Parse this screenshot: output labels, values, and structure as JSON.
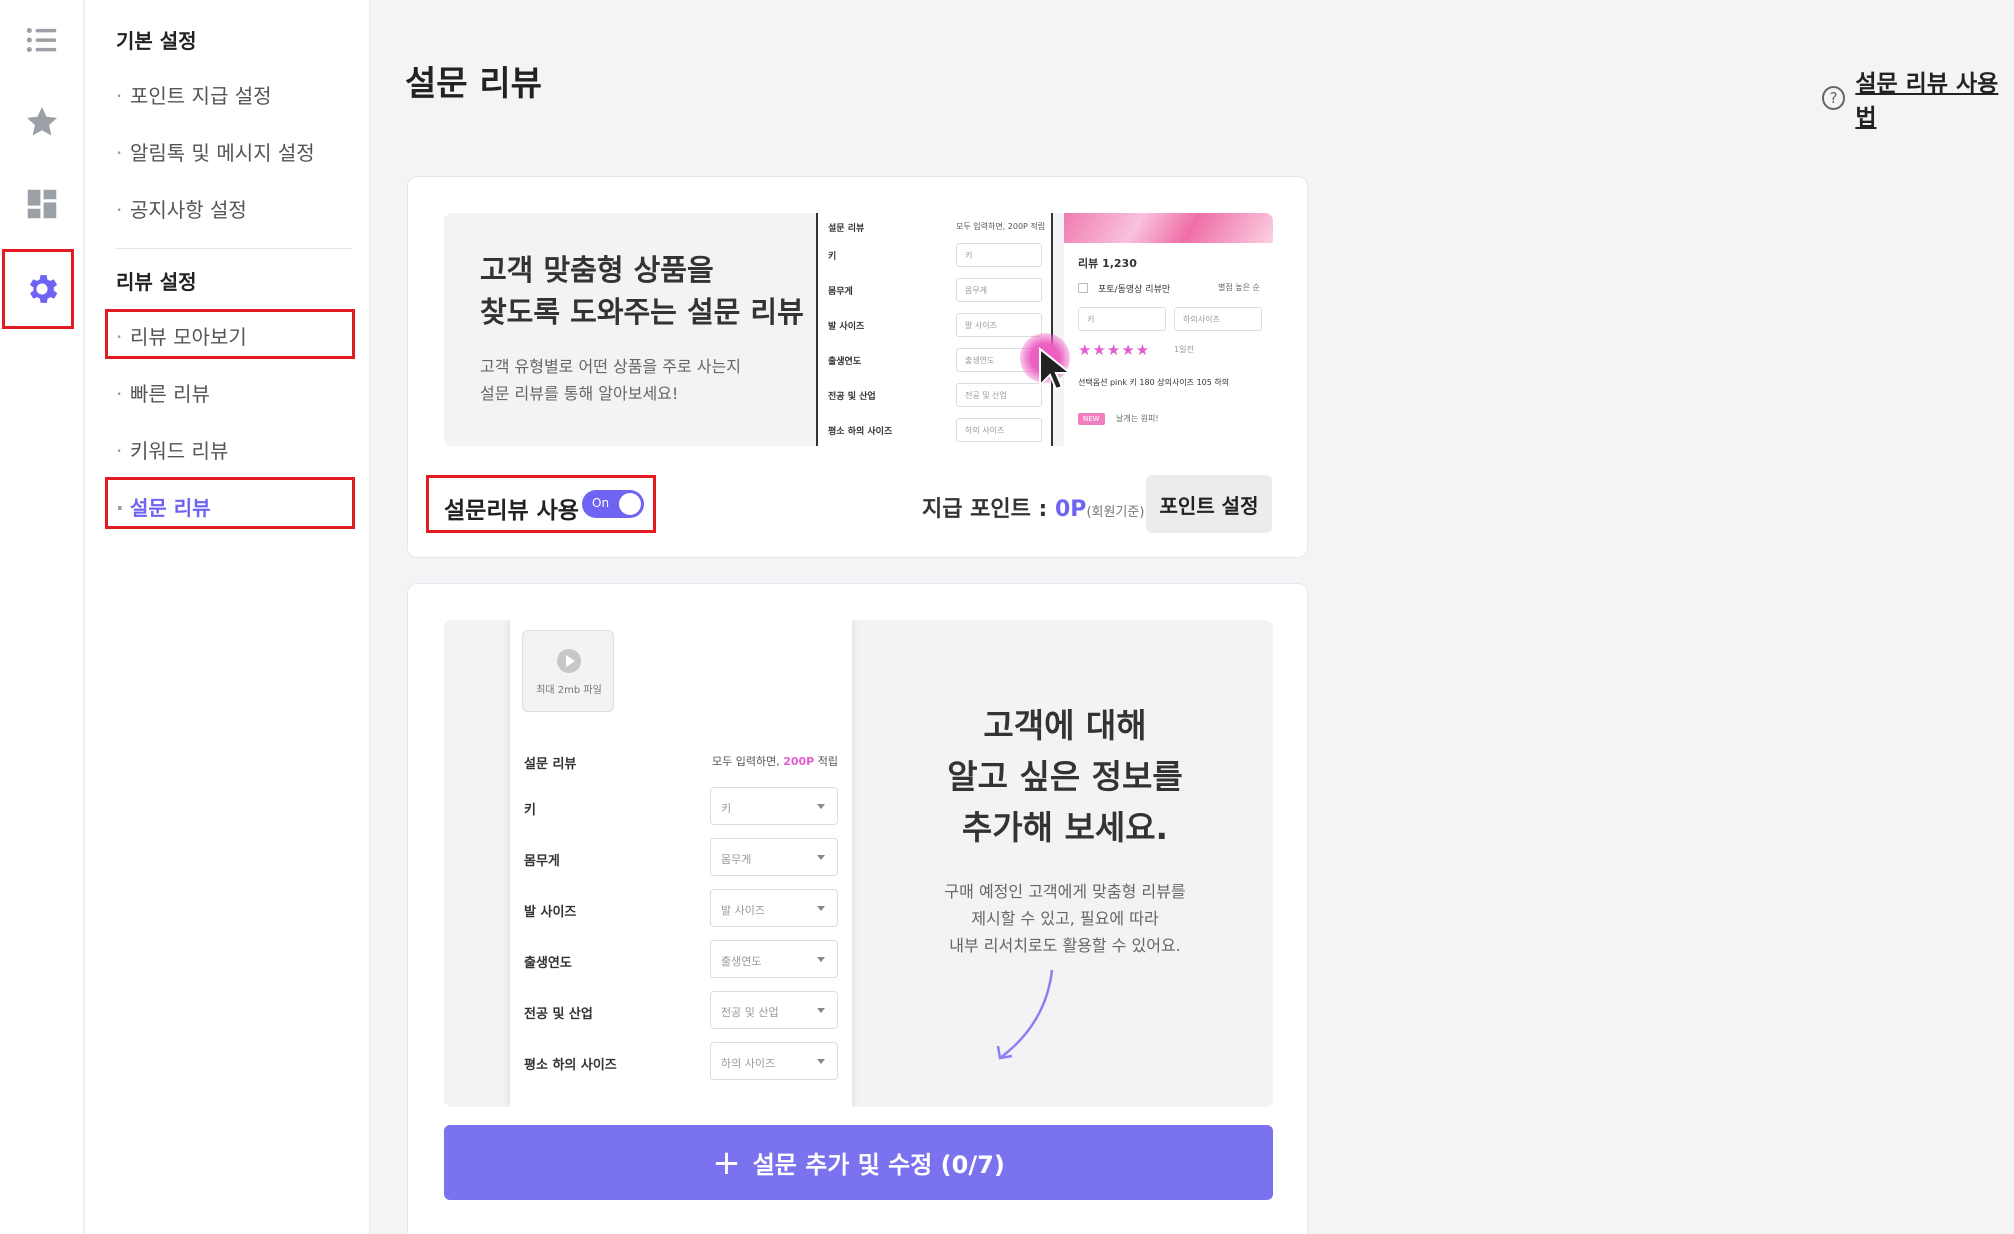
{
  "rail": {
    "items": [
      {
        "icon": "list-icon"
      },
      {
        "icon": "star-icon"
      },
      {
        "icon": "dashboard-icon"
      },
      {
        "icon": "gear-icon",
        "active": true
      }
    ]
  },
  "sidebar": {
    "groups": [
      {
        "title": "기본 설정",
        "items": [
          "포인트 지급 설정",
          "알림톡 및 메시지 설정",
          "공지사항 설정"
        ]
      },
      {
        "title": "리뷰 설정",
        "items": [
          "리뷰 모아보기",
          "빠른 리뷰",
          "키워드 리뷰",
          "설문 리뷰"
        ]
      }
    ],
    "current": "설문 리뷰"
  },
  "page": {
    "title": "설문 리뷰",
    "help_link": "설문 리뷰 사용법"
  },
  "card1": {
    "banner_title": "고객 맞춤형 상품을\n찾도록 도와주는 설문 리뷰",
    "banner_sub": "고객 유형별로 어떤 상품을 주로 사는지\n설문 리뷰를 통해 알아보세요!",
    "mini_form": {
      "title": "설문 리뷰",
      "note": "모두 입력하면, 200P 적립",
      "rows": [
        {
          "label": "키",
          "value": "키"
        },
        {
          "label": "몸무게",
          "value": "몸무게"
        },
        {
          "label": "발 사이즈",
          "value": "발 사이즈"
        },
        {
          "label": "출생연도",
          "value": "출생연도"
        },
        {
          "label": "전공 및 산업",
          "value": "전공 및 산업"
        },
        {
          "label": "평소 하의 사이즈",
          "value": "하의 사이즈"
        }
      ]
    },
    "mini_review": {
      "count": "리뷰 1,230",
      "filter": "포토/동영상 리뷰만",
      "sort": "별점 높은 순",
      "sel1": "키",
      "sel2": "하의사이즈",
      "stars": "★★★★★",
      "date": "1일전",
      "options": "선택옵션 pink  키 180  상의사이즈 105  하의",
      "badge": "NEW",
      "review_text": "날개는 원피!"
    },
    "toggle_label": "설문리뷰 사용",
    "toggle_state": "On",
    "points_label": "지급 포인트 :",
    "points_value": "0P",
    "points_note": "(회원기준)",
    "points_button": "포인트 설정"
  },
  "card2": {
    "upload_caption": "최대 2mb 파일",
    "form_title": "설문 리뷰",
    "form_note_prefix": "모두 입력하면,",
    "form_note_points": "200P",
    "form_note_suffix": "적립",
    "rows": [
      {
        "label": "키",
        "placeholder": "키"
      },
      {
        "label": "몸무게",
        "placeholder": "몸무게"
      },
      {
        "label": "발 사이즈",
        "placeholder": "발 사이즈"
      },
      {
        "label": "출생연도",
        "placeholder": "출생연도"
      },
      {
        "label": "전공 및 산업",
        "placeholder": "전공 및 산업"
      },
      {
        "label": "평소 하의 사이즈",
        "placeholder": "하의 사이즈"
      }
    ],
    "headline": "고객에 대해\n알고 싶은 정보를\n추가해 보세요.",
    "description": "구매 예정인 고객에게 맞춤형 리뷰를\n제시할 수 있고, 필요에 따라\n내부 리서치로도 활용할 수 있어요.",
    "add_button": "설문 추가 및 수정 (0/7)"
  },
  "colors": {
    "accent": "#6e63f2",
    "button": "#7b72f0",
    "highlight": "#e31c23",
    "pink": "#e45bd3"
  }
}
